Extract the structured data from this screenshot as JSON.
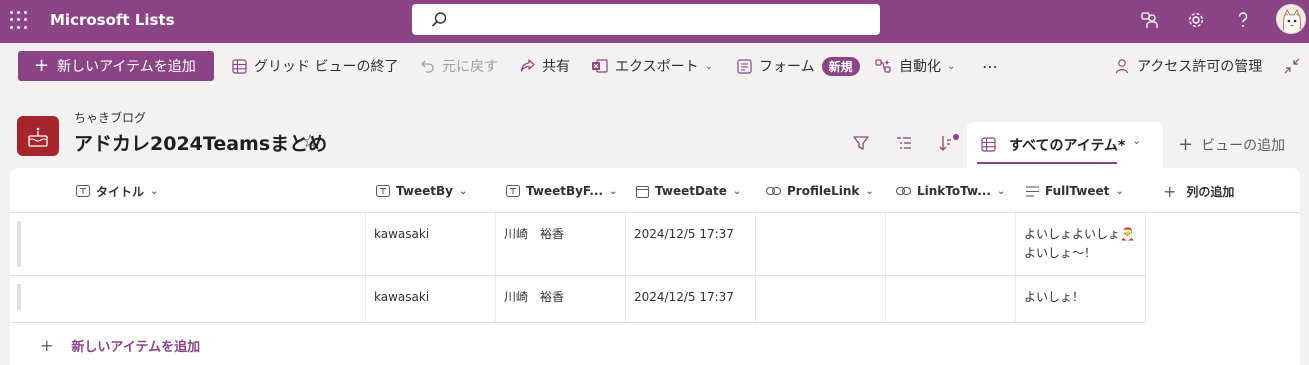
{
  "topbar": {
    "app_name": "Microsoft Lists",
    "search_placeholder": "",
    "icons": [
      "waffle-icon",
      "search-icon",
      "feedback-icon",
      "settings-icon",
      "help-icon",
      "avatar"
    ],
    "color": "#8b4587"
  },
  "commandbar": {
    "new_item": "新しいアイテムを追加",
    "exit_grid": "グリッド ビューの終了",
    "undo": "元に戻す",
    "share": "共有",
    "export": "エクスポート",
    "forms": "フォーム",
    "forms_badge": "新規",
    "automate": "自動化",
    "more": "⋯",
    "manage_access": "アクセス許可の管理"
  },
  "list": {
    "site_name": "ちゃきブログ",
    "title": "アドカレ2024Teamsまとめ",
    "view_name": "すべてのアイテム*",
    "add_view": "ビューの追加"
  },
  "grid": {
    "columns": [
      {
        "label": "タイトル",
        "icon": "text-icon"
      },
      {
        "label": "TweetBy",
        "icon": "text-icon"
      },
      {
        "label": "TweetByF...",
        "icon": "text-icon"
      },
      {
        "label": "TweetDate",
        "icon": "calendar-icon"
      },
      {
        "label": "ProfileLink",
        "icon": "link-icon"
      },
      {
        "label": "LinkToTw...",
        "icon": "link-icon"
      },
      {
        "label": "FullTweet",
        "icon": "multiline-text-icon"
      }
    ],
    "add_column": "列の追加",
    "rows": [
      {
        "title": "",
        "tweet_by": "kawasaki",
        "tweet_by_full": "川崎　裕香",
        "tweet_date": "2024/12/5 17:37",
        "profile_link": "",
        "link_to_tweet": "",
        "full_tweet_line1": "よいしょよいしょ🎅",
        "full_tweet_line2": "よいしょ～！"
      },
      {
        "title": "",
        "tweet_by": "kawasaki",
        "tweet_by_full": "川崎　裕香",
        "tweet_date": "2024/12/5 17:37",
        "profile_link": "",
        "link_to_tweet": "",
        "full_tweet_line1": "よいしょ！",
        "full_tweet_line2": ""
      }
    ],
    "add_item": "新しいアイテムを追加"
  }
}
